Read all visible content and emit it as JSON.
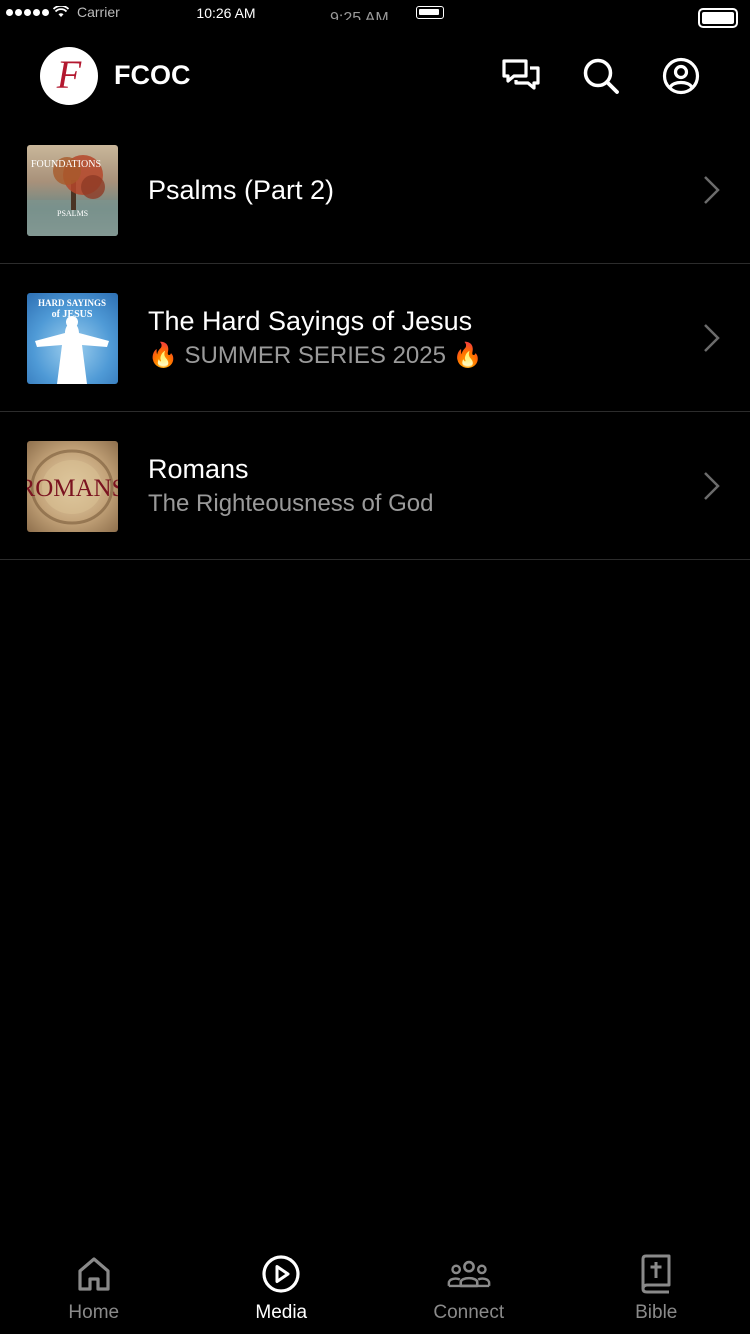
{
  "status_bar": {
    "time": "10:26 AM",
    "carrier": "Carrier",
    "ghost_time": "9:25 AM"
  },
  "header": {
    "logo_letter": "F",
    "title": "FCOC",
    "icons": [
      "chat-icon",
      "search-icon",
      "account-icon"
    ]
  },
  "series": [
    {
      "title": "Psalms (Part 2)",
      "subtitle": "",
      "thumb_line1": "FOUNDATIONS",
      "thumb_line2": "PSALMS"
    },
    {
      "title": "The Hard Sayings of Jesus",
      "subtitle": "🔥 SUMMER SERIES 2025 🔥",
      "thumb_line1": "HARD SAYINGS",
      "thumb_line2": "of JESUS"
    },
    {
      "title": "Romans",
      "subtitle": "The Righteousness of God",
      "thumb_line1": "ROMANS",
      "thumb_line2": ""
    }
  ],
  "tabs": [
    {
      "label": "Home",
      "icon": "home-icon",
      "active": false
    },
    {
      "label": "Media",
      "icon": "play-circle-icon",
      "active": true
    },
    {
      "label": "Connect",
      "icon": "people-icon",
      "active": false
    },
    {
      "label": "Bible",
      "icon": "bible-icon",
      "active": false
    }
  ],
  "colors": {
    "background": "#000000",
    "brand_red": "#b3182f",
    "muted_text": "#9a9a9a",
    "divider": "#2c2c2c"
  }
}
